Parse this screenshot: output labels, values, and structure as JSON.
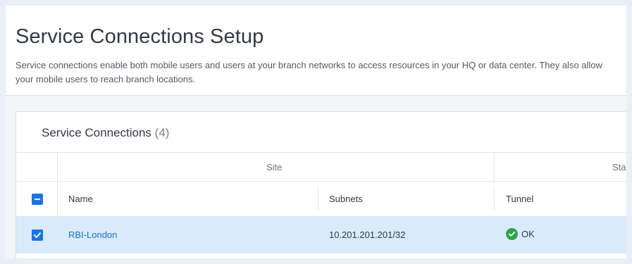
{
  "page": {
    "title": "Service Connections Setup",
    "description": "Service connections enable both mobile users and users at your branch networks to access resources in your HQ or data center. They also allow your mobile users to reach branch locations."
  },
  "section": {
    "title": "Service Connections",
    "count": "(4)"
  },
  "table": {
    "groups": {
      "site": "Site",
      "status": "Stat"
    },
    "columns": {
      "name": "Name",
      "subnets": "Subnets",
      "tunnel": "Tunnel"
    },
    "select_all_state": "indeterminate",
    "rows": [
      {
        "selected": true,
        "name": "RBI-London",
        "subnets": "10.201.201.201/32",
        "tunnel_status": "OK",
        "tunnel_icon": "check-circle-icon"
      }
    ]
  },
  "colors": {
    "accent": "#1a73e8",
    "link": "#1a6fd1",
    "row_selected": "#d9ebfa",
    "status_ok": "#31a24c"
  }
}
